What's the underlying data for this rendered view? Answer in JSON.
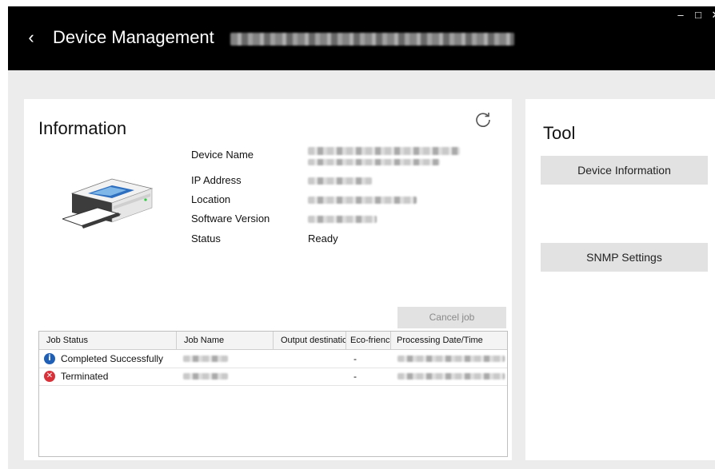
{
  "window": {
    "title": "Device Management",
    "controls": {
      "minimize": "‒",
      "maximize": "□",
      "close": "✕"
    },
    "back": "‹"
  },
  "info": {
    "heading": "Information",
    "fields": [
      {
        "label": "Device Name"
      },
      {
        "label": "IP Address"
      },
      {
        "label": "Location"
      },
      {
        "label": "Software Version"
      },
      {
        "label": "Status",
        "value": "Ready"
      }
    ],
    "cancel_job": "Cancel job",
    "table": {
      "headers": [
        "Job Status",
        "Job Name",
        "Output destinatio",
        "Eco-frienc",
        "Processing Date/Time"
      ],
      "rows": [
        {
          "status": "Completed Successfully",
          "status_icon": "info-icon",
          "icon_color": "#1f5fb5",
          "eco": "-"
        },
        {
          "status": "Terminated",
          "status_icon": "error-icon",
          "icon_color": "#d9313a",
          "eco": "-"
        }
      ]
    }
  },
  "tool": {
    "heading": "Tool",
    "buttons": [
      "Device Information",
      "SNMP Settings"
    ]
  }
}
